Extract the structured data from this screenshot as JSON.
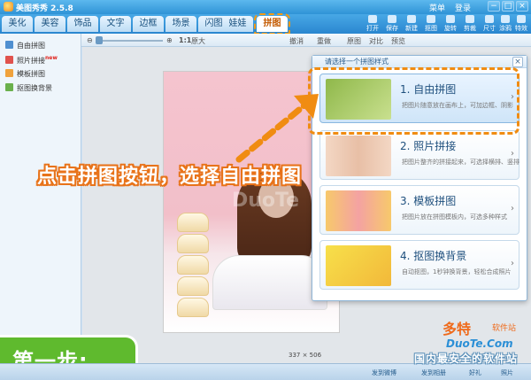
{
  "window": {
    "title": "美图秀秀 2.5.8",
    "menu": "菜单",
    "login": "登录"
  },
  "window_controls": [
    "−",
    "□",
    "×"
  ],
  "tabs": [
    "美化",
    "美容",
    "饰品",
    "文字",
    "边框",
    "场景",
    "闪图",
    "娃娃",
    "拼图"
  ],
  "tools": [
    "打开",
    "保存",
    "新建",
    "抠图",
    "旋转",
    "剪裁",
    "尺寸",
    "涂鸦",
    "特效"
  ],
  "subbar": {
    "ratio": "1:1",
    "ratio_label": "原大",
    "undo": "撤消",
    "redo": "重做",
    "original": "原图",
    "compare": "对比",
    "preview": "预览"
  },
  "sidebar": {
    "items": [
      {
        "label": "自由拼图",
        "new": ""
      },
      {
        "label": "照片拼接",
        "new": "new"
      },
      {
        "label": "模板拼图",
        "new": ""
      },
      {
        "label": "抠图换背景",
        "new": ""
      }
    ]
  },
  "panel": {
    "heading": "请选择一个拼图样式",
    "close": "×",
    "options": [
      {
        "title": "1. 自由拼图",
        "desc": "把图片随意放在画布上，可加边框、阴影"
      },
      {
        "title": "2. 照片拼接",
        "desc": "把图片整齐的拼接起来，可选择横排、竖排"
      },
      {
        "title": "3. 模板拼图",
        "desc": "把图片放在拼图模板内，可选多种样式"
      },
      {
        "title": "4. 抠图换背景",
        "desc": "自动抠图，1秒钟换背景，轻松合成照片"
      }
    ]
  },
  "instruction": "点击拼图按钮，选择自由拼图",
  "photo_size": "337 × 506",
  "watermark": {
    "center": "DuoTe",
    "brand": "多特",
    "sub": "软件站",
    "url": "DuoTe.Com",
    "slogan": "国内最安全的软件站"
  },
  "step": "第一步:",
  "status": {
    "weibo": "发到微博",
    "album": "发到相册",
    "gift": "好礼",
    "photo": "照片"
  },
  "colors": {
    "accent_orange": "#f08c12",
    "brand_blue": "#2f93d6",
    "step_green": "#5fba2e"
  }
}
